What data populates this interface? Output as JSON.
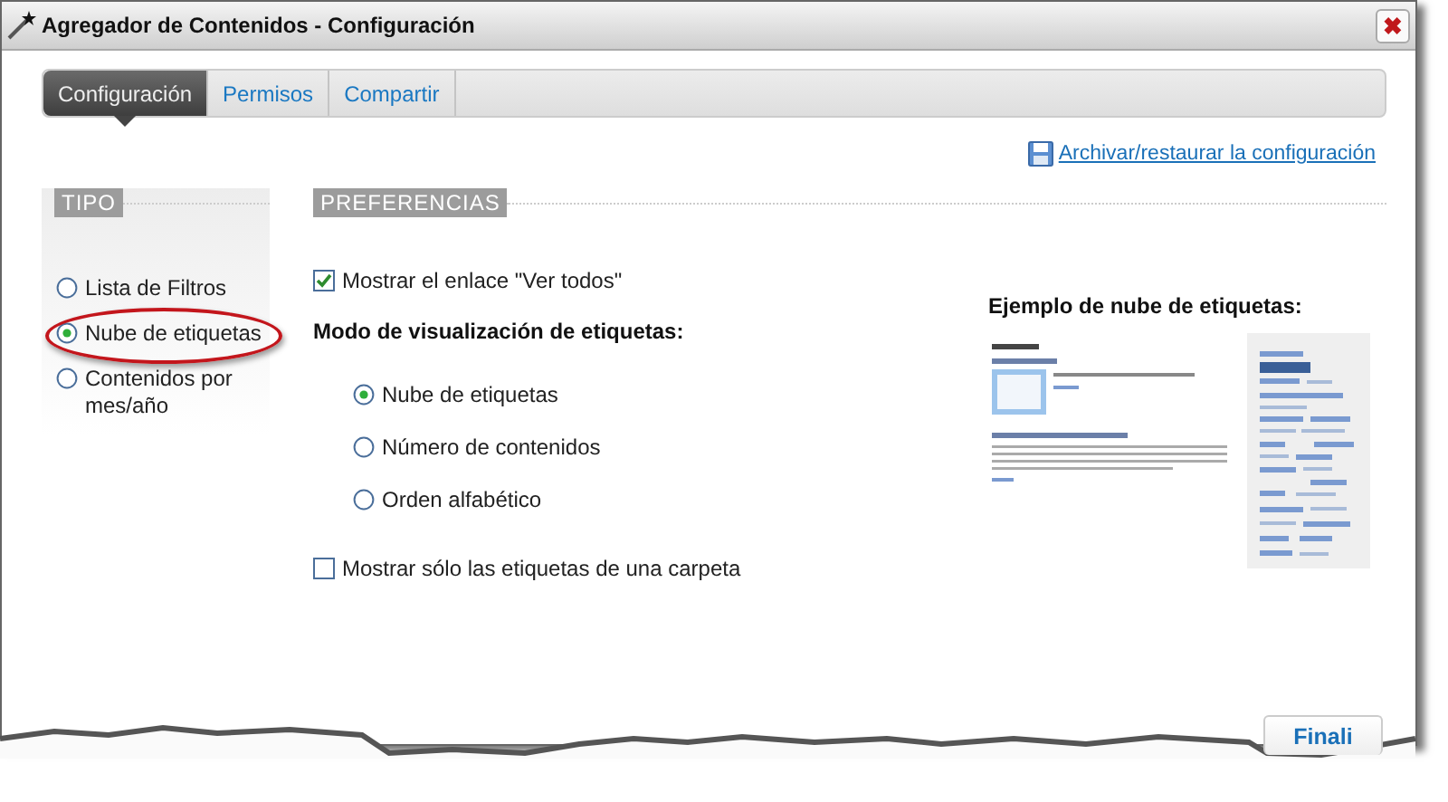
{
  "window": {
    "title": "Agregador de Contenidos - Configuración",
    "close": "✖"
  },
  "tabs": [
    {
      "label": "Configuración",
      "selected": true
    },
    {
      "label": "Permisos",
      "selected": false
    },
    {
      "label": "Compartir",
      "selected": false
    }
  ],
  "archive_link": "Archivar/restaurar la configuración",
  "tipo": {
    "heading": "TIPO",
    "options": [
      {
        "label": "Lista de Filtros",
        "selected": false,
        "highlighted": false
      },
      {
        "label": "Nube de etiquetas",
        "selected": true,
        "highlighted": true
      },
      {
        "label": "Contenidos por mes/año",
        "selected": false,
        "highlighted": false
      }
    ]
  },
  "preferencias": {
    "heading": "PREFERENCIAS",
    "show_all": {
      "label": "Mostrar el enlace \"Ver todos\"",
      "checked": true
    },
    "mode_heading": "Modo de visualización de etiquetas:",
    "modes": [
      {
        "label": "Nube de etiquetas",
        "selected": true
      },
      {
        "label": "Número de contenidos",
        "selected": false
      },
      {
        "label": "Orden alfabético",
        "selected": false
      }
    ],
    "folder_only": {
      "label": "Mostrar sólo las etiquetas de una carpeta",
      "checked": false
    }
  },
  "example": {
    "heading": "Ejemplo de nube de etiquetas:"
  },
  "finish_button": "Finali"
}
